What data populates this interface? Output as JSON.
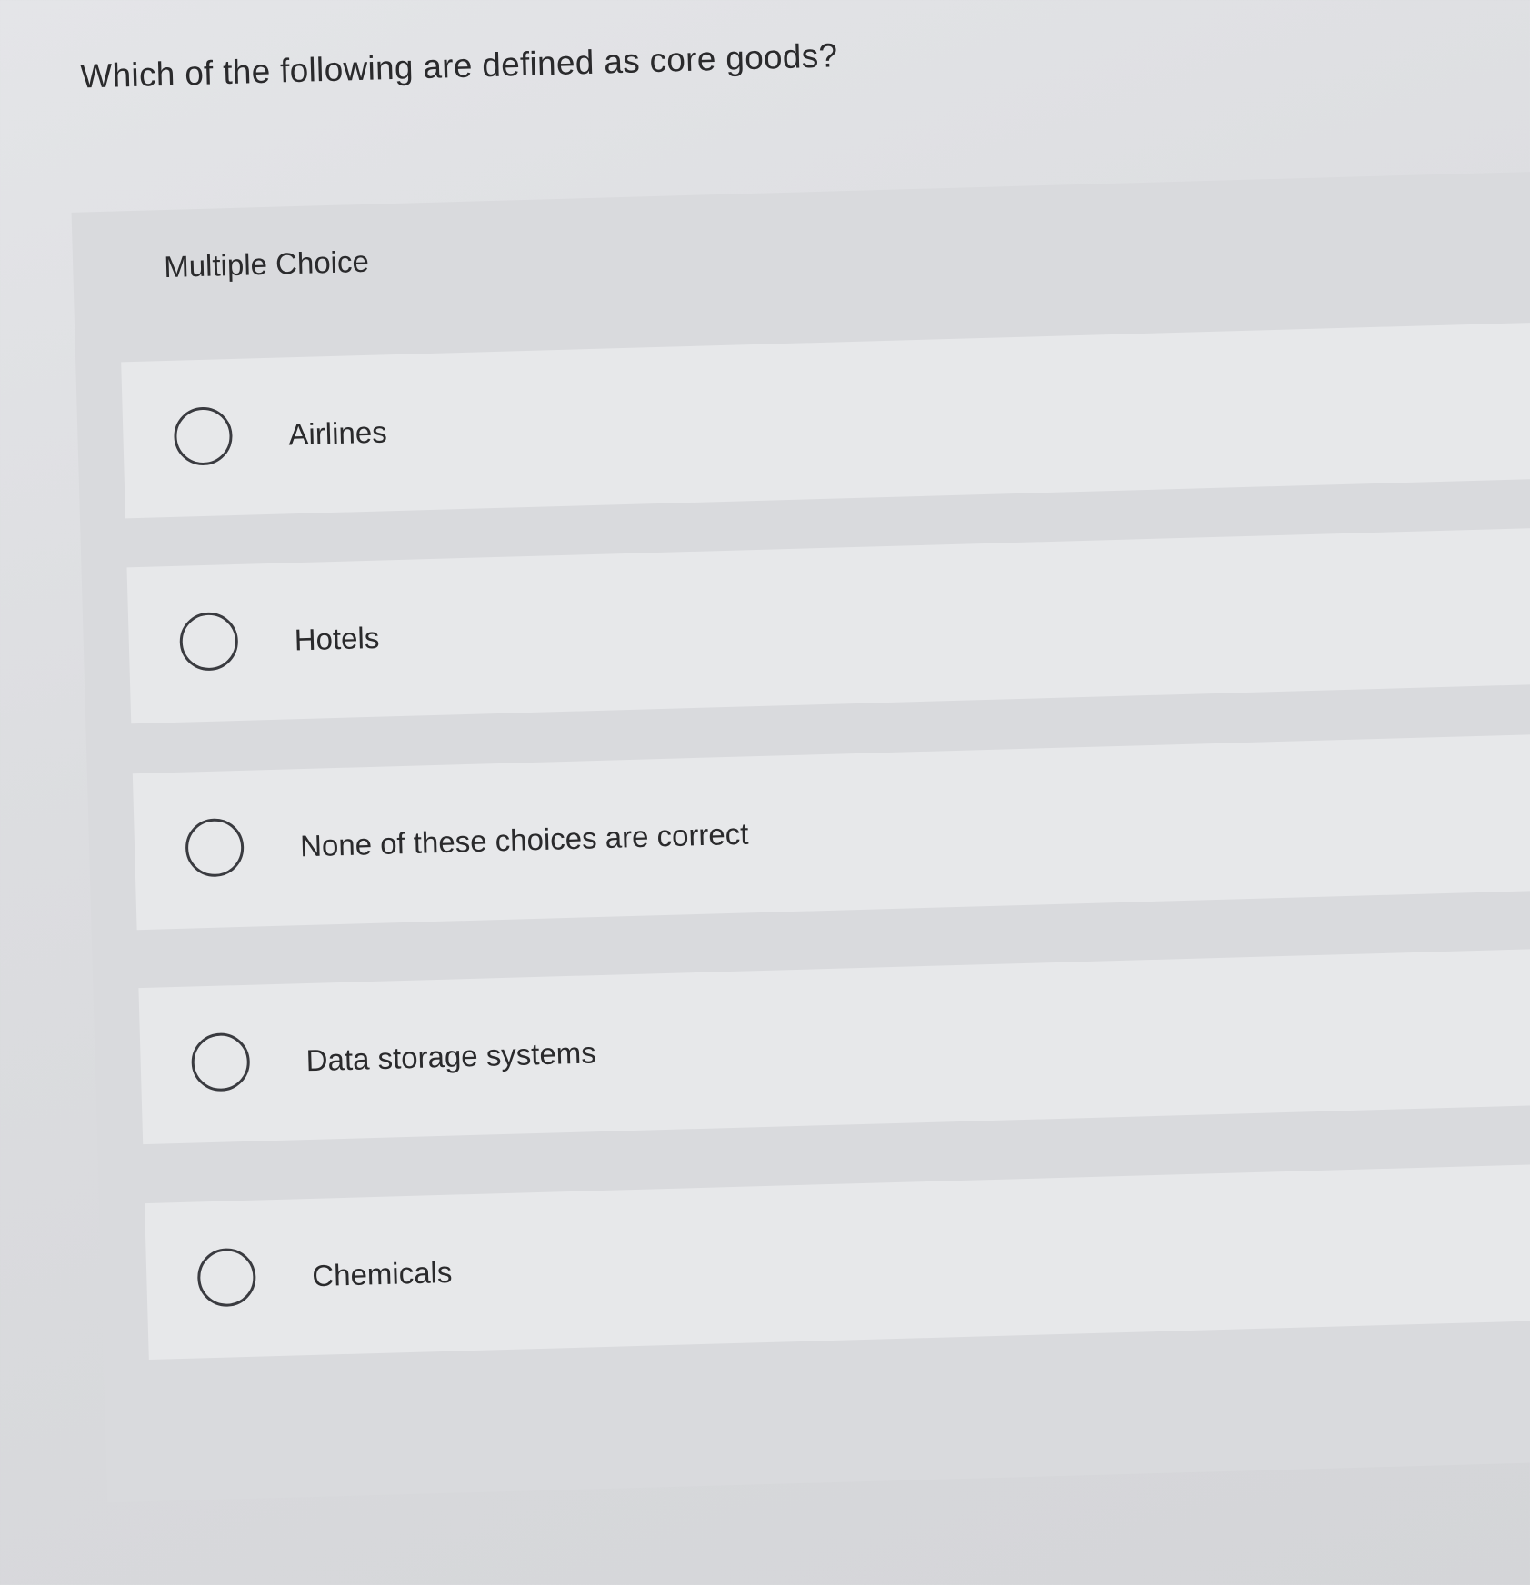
{
  "question": {
    "text": "Which of the following are defined as core goods?"
  },
  "multiple_choice": {
    "label": "Multiple Choice",
    "options": [
      {
        "label": "Airlines",
        "selected": false
      },
      {
        "label": "Hotels",
        "selected": false
      },
      {
        "label": "None of these choices are correct",
        "selected": false
      },
      {
        "label": "Data storage systems",
        "selected": false
      },
      {
        "label": "Chemicals",
        "selected": false
      }
    ]
  }
}
